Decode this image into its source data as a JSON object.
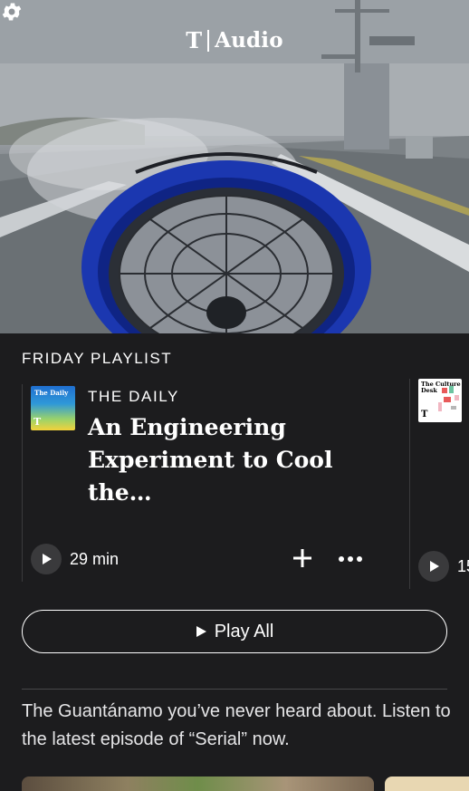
{
  "header": {
    "logo_mark": "T",
    "app_name": "Audio"
  },
  "icons": {
    "settings": "gear-icon",
    "play": "play-icon",
    "add": "plus-icon",
    "more": "more-dots-icon"
  },
  "playlist": {
    "section_title": "FRIDAY PLAYLIST",
    "items": [
      {
        "show": "THE DAILY",
        "art_label": "The Daily",
        "art_mark": "T",
        "title": "An Engineering Experiment to Cool the…",
        "duration": "29 min"
      },
      {
        "art_label": "The Culture Desk",
        "art_mark": "T",
        "duration": "15"
      }
    ],
    "play_all_label": "Play All"
  },
  "promo": {
    "text": "The Guantánamo you’ve never heard about. Listen to the latest episode of “Serial” now."
  },
  "colors": {
    "background": "#1c1c1e",
    "button_bg": "#3a3a3c",
    "text": "#ffffff",
    "fan_blue": "#1f3fc4"
  }
}
